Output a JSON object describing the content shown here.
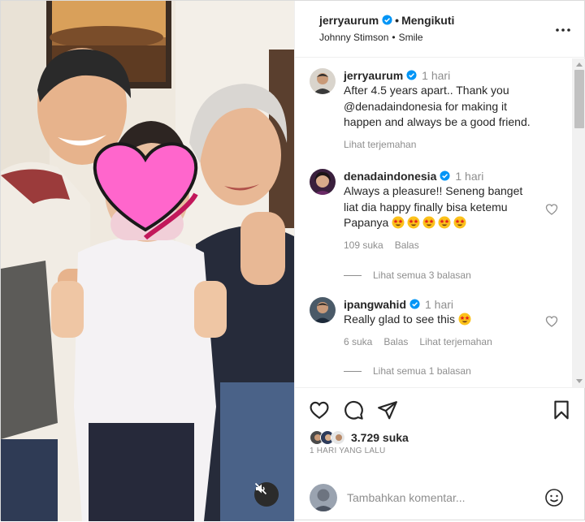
{
  "post": {
    "author": "jerryaurum",
    "follow_status": "Mengikuti",
    "audio_artist": "Johnny Stimson",
    "audio_track": "Smile",
    "caption_time": "1 hari",
    "caption_lines": [
      "After 4.5 years apart.. Thank you",
      "@denadaindonesia for making it",
      "happen and always be a good friend."
    ],
    "translate_label": "Lihat terjemahan"
  },
  "comments": [
    {
      "user": "denadaindonesia",
      "time": "1 hari",
      "lines": [
        "Always a pleasure!! Seneng banget",
        "liat dia happy finally bisa ketemu"
      ],
      "line3_text": "Papanya",
      "likes": "109 suka",
      "reply_label": "Balas",
      "view_replies": "Lihat semua 3 balasan"
    },
    {
      "user": "ipangwahid",
      "time": "1 hari",
      "text": "Really glad to see this",
      "likes": "6 suka",
      "reply_label": "Balas",
      "translate_label": "Lihat terjemahan",
      "view_replies": "Lihat semua 1 balasan"
    }
  ],
  "stats": {
    "likes": "3.729 suka",
    "posted": "1 HARI YANG LALU"
  },
  "composer": {
    "placeholder": "Tambahkan komentar..."
  },
  "icons": {
    "verified": "verified-badge-icon",
    "more": "more-options-icon",
    "like": "heart-icon",
    "comment": "comment-bubble-icon",
    "share": "paper-plane-icon",
    "save": "bookmark-icon",
    "emoji": "smiley-icon",
    "mute": "speaker-muted-icon",
    "reaction": "star-struck-emoji-icon"
  },
  "colors": {
    "verified_blue": "#0095f6",
    "text": "#262626",
    "muted_text": "#8e8e8e",
    "heart_censor": "#ff66cc"
  }
}
